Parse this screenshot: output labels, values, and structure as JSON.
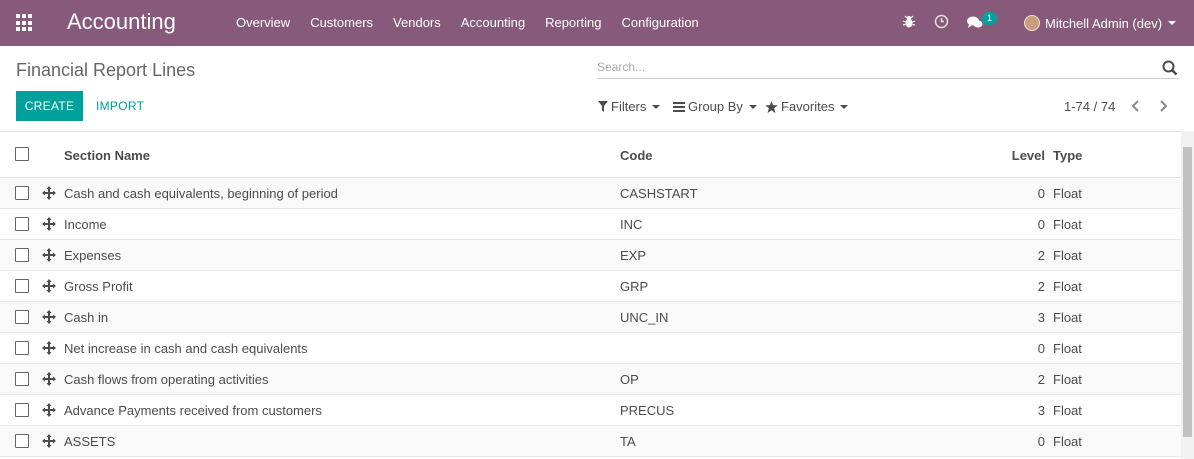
{
  "navbar": {
    "brand": "Accounting",
    "menu": [
      "Overview",
      "Customers",
      "Vendors",
      "Accounting",
      "Reporting",
      "Configuration"
    ],
    "icons": [
      "apps-grid-icon",
      "bug-icon",
      "clock-icon",
      "chat-icon"
    ],
    "messages_count": "1",
    "user": "Mitchell Admin (dev)",
    "color": "#875a7b"
  },
  "control_panel": {
    "title": "Financial Report Lines",
    "search_placeholder": "Search...",
    "create_label": "CREATE",
    "import_label": "IMPORT",
    "filters_label": "Filters",
    "groupby_label": "Group By",
    "favorites_label": "Favorites",
    "pager": "1-74 / 74",
    "accent": "#00a09d"
  },
  "table": {
    "headers": {
      "name": "Section Name",
      "code": "Code",
      "level": "Level",
      "type": "Type"
    },
    "rows": [
      {
        "name": "Cash and cash equivalents, beginning of period",
        "code": "CASHSTART",
        "level": "0",
        "type": "Float"
      },
      {
        "name": "Income",
        "code": "INC",
        "level": "0",
        "type": "Float"
      },
      {
        "name": "Expenses",
        "code": "EXP",
        "level": "2",
        "type": "Float"
      },
      {
        "name": "Gross Profit",
        "code": "GRP",
        "level": "2",
        "type": "Float"
      },
      {
        "name": "Cash in",
        "code": "UNC_IN",
        "level": "3",
        "type": "Float"
      },
      {
        "name": "Net increase in cash and cash equivalents",
        "code": "",
        "level": "0",
        "type": "Float"
      },
      {
        "name": "Cash flows from operating activities",
        "code": "OP",
        "level": "2",
        "type": "Float"
      },
      {
        "name": "Advance Payments received from customers",
        "code": "PRECUS",
        "level": "3",
        "type": "Float"
      },
      {
        "name": "ASSETS",
        "code": "TA",
        "level": "0",
        "type": "Float"
      }
    ]
  }
}
